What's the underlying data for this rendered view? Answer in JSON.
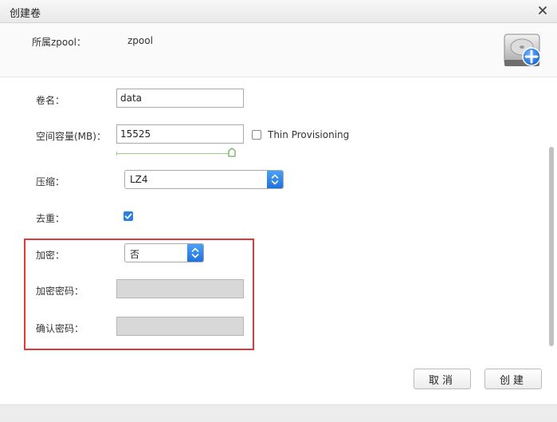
{
  "window": {
    "title": "创建卷"
  },
  "header": {
    "pool_label": "所属zpool：",
    "pool_value": "zpool"
  },
  "form": {
    "volume_name": {
      "label": "卷名：",
      "value": "data"
    },
    "capacity": {
      "label": "空间容量(MB)：",
      "value": "15525",
      "slider_fraction": 1.0
    },
    "thin_provisioning": {
      "label": "Thin Provisioning",
      "checked": false
    },
    "compression": {
      "label": "压缩：",
      "selected": "LZ4"
    },
    "dedup": {
      "label": "去重：",
      "checked": true
    },
    "encryption": {
      "label": "加密：",
      "selected": "否"
    },
    "encryption_password": {
      "label": "加密密码：",
      "value": ""
    },
    "confirm_password": {
      "label": "确认密码：",
      "value": ""
    }
  },
  "buttons": {
    "cancel": "取消",
    "create": "创建"
  },
  "icons": {
    "close": "close-icon",
    "disk": "hard-disk-add-icon",
    "check": "check-icon",
    "stepper": "stepper-arrows-icon"
  },
  "colors": {
    "accent": "#2a7ee6",
    "highlight": "#e23a3a",
    "slider": "#9ccf8d"
  }
}
